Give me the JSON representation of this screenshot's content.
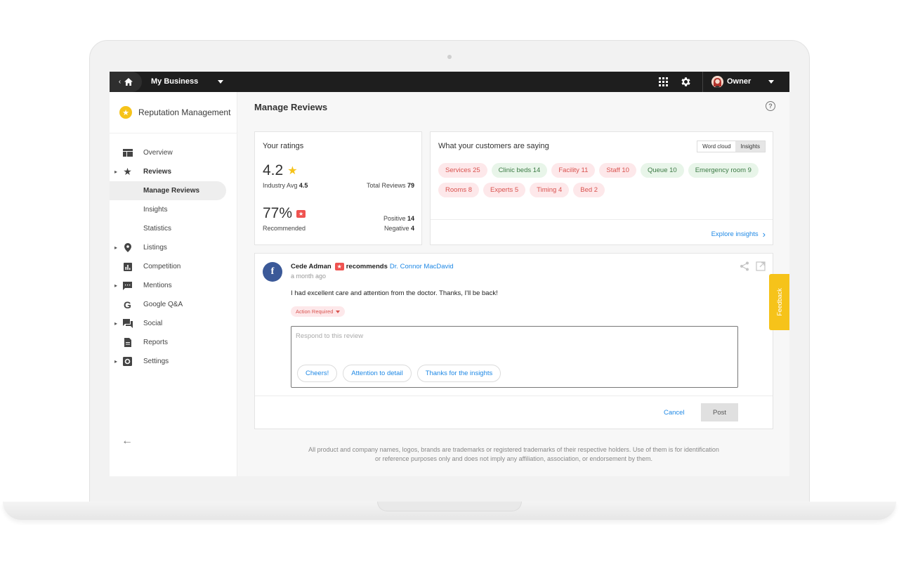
{
  "topbar": {
    "business": "My Business",
    "user": "Owner"
  },
  "sidebar": {
    "brand": "Reputation Management",
    "items": [
      {
        "label": "Overview",
        "icon": "overview-icon"
      },
      {
        "label": "Reviews",
        "icon": "star-icon"
      },
      {
        "label": "Manage Reviews"
      },
      {
        "label": "Insights"
      },
      {
        "label": "Statistics"
      },
      {
        "label": "Listings",
        "icon": "location-pin-icon"
      },
      {
        "label": "Competition",
        "icon": "bar-chart-icon"
      },
      {
        "label": "Mentions",
        "icon": "chat-icon"
      },
      {
        "label": "Google Q&A",
        "icon": "google-icon"
      },
      {
        "label": "Social",
        "icon": "forum-icon"
      },
      {
        "label": "Reports",
        "icon": "document-icon"
      },
      {
        "label": "Settings",
        "icon": "gear-icon"
      }
    ]
  },
  "main": {
    "title": "Manage Reviews",
    "ratings": {
      "title": "Your ratings",
      "score": "4.2",
      "industry_label": "Industry Avg",
      "industry_value": "4.5",
      "total_label": "Total Reviews",
      "total_value": "79",
      "recommended_pct": "77%",
      "recommended_label": "Recommended",
      "positive_label": "Positive",
      "positive_value": "14",
      "negative_label": "Negative",
      "negative_value": "4"
    },
    "saying": {
      "title": "What your customers are saying",
      "toggle": [
        "Word cloud",
        "Insights"
      ],
      "chips": [
        {
          "label": "Services 25",
          "sentiment": "negative"
        },
        {
          "label": "Clinic beds 14",
          "sentiment": "positive"
        },
        {
          "label": "Facility 11",
          "sentiment": "negative"
        },
        {
          "label": "Staff 10",
          "sentiment": "negative"
        },
        {
          "label": "Queue 10",
          "sentiment": "positive"
        },
        {
          "label": "Emergency room 9",
          "sentiment": "positive"
        },
        {
          "label": "Rooms 8",
          "sentiment": "negative"
        },
        {
          "label": "Experts 5",
          "sentiment": "negative"
        },
        {
          "label": "Timing 4",
          "sentiment": "negative"
        },
        {
          "label": "Bed 2",
          "sentiment": "negative"
        }
      ],
      "explore": "Explore insights"
    },
    "review": {
      "author": "Cede Adman",
      "verb": "recommends",
      "target": "Dr. Connor MacDavid",
      "time": "a month ago",
      "text": "I had excellent care and attention from the doctor. Thanks, I'll be back!",
      "status": "Action Required",
      "reply_placeholder": "Respond to this review",
      "quick_replies": [
        "Cheers!",
        "Attention to detail",
        "Thanks for the insights"
      ],
      "cancel": "Cancel",
      "post": "Post"
    },
    "footer_line1": "All product and company names, logos, brands are trademarks or registered trademarks of their respective holders. Use of them is for identification",
    "footer_line2": "or reference purposes only and does not imply any affiliation, association, or endorsement by them."
  },
  "feedback": "Feedback",
  "colors": {
    "accent_blue": "#1e88e5",
    "brand_yellow": "#f6c31a",
    "negative": "#d9534f",
    "positive": "#3c7a45",
    "facebook": "#3b5998"
  }
}
